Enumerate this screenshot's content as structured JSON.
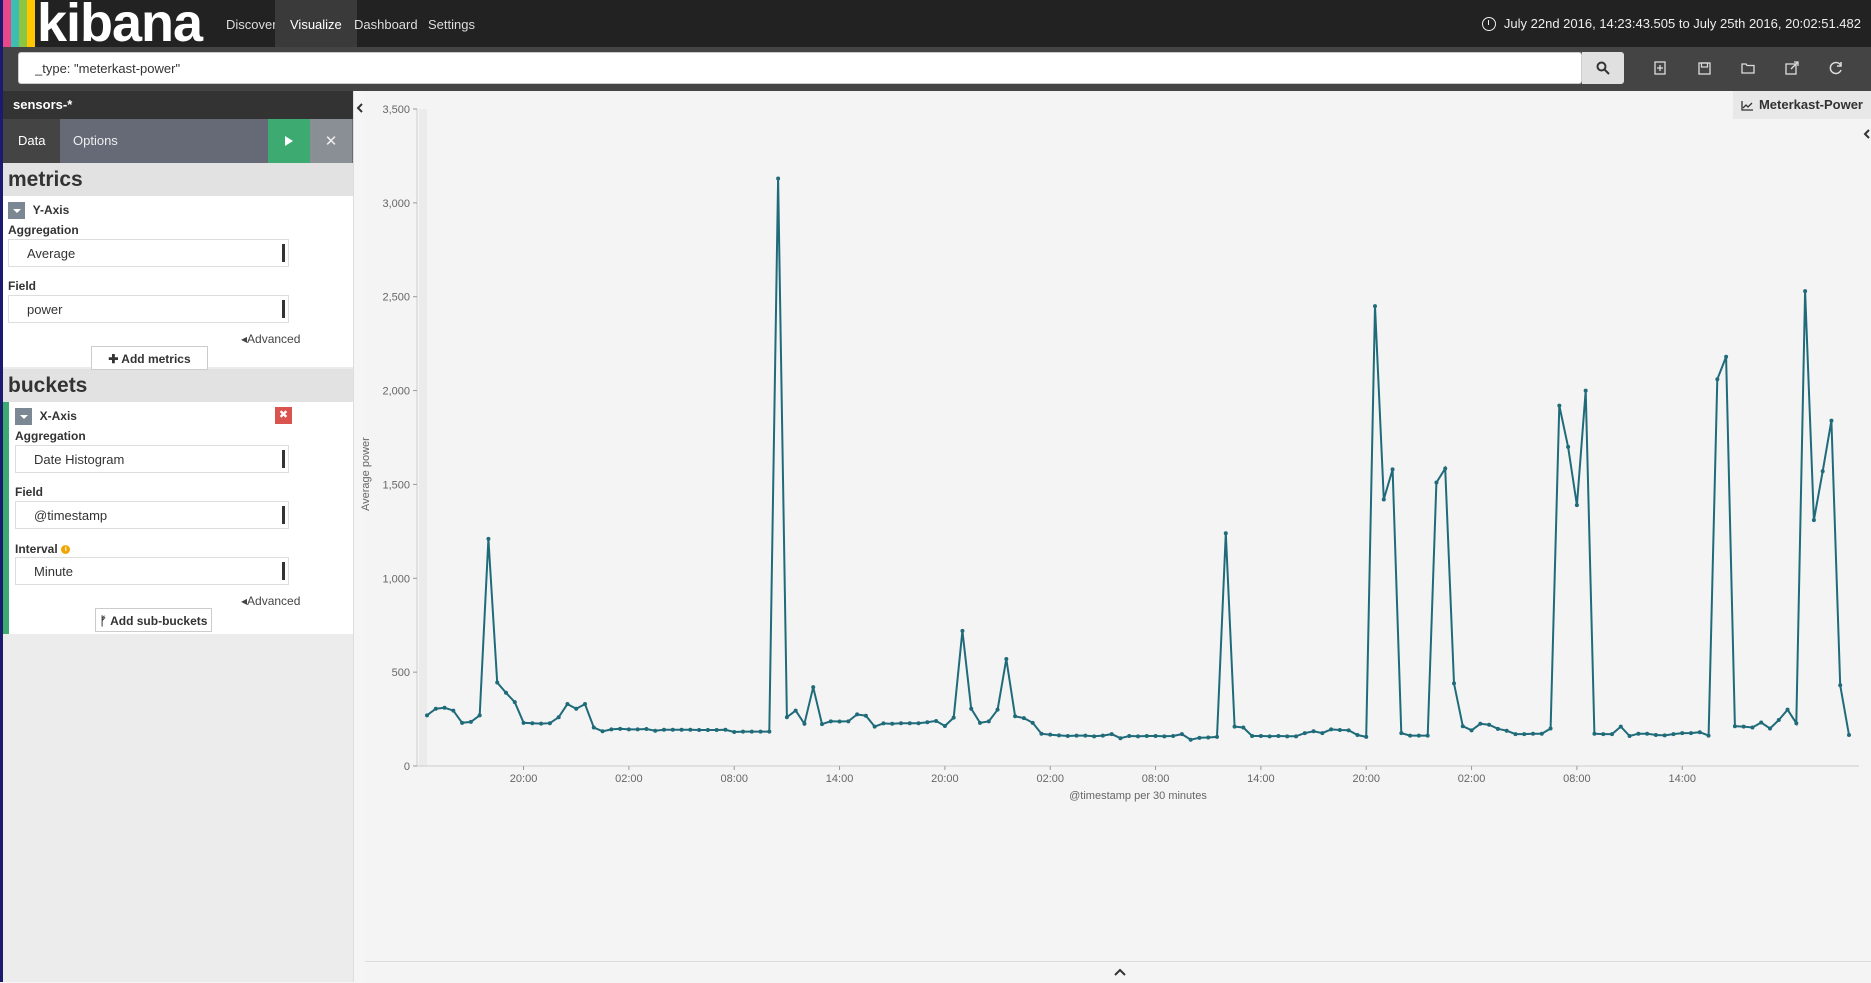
{
  "colors": {
    "navbar_bg": "#222222",
    "accent_green": "#3caa71",
    "line_color": "#1f6b7a",
    "delete_red": "#d9534f",
    "logo_stripes": [
      "#e8478b",
      "#3ebeb0",
      "#8bc541",
      "#ffc700"
    ]
  },
  "nav": {
    "brand": "kibana",
    "items": [
      "Discover",
      "Visualize",
      "Dashboard",
      "Settings"
    ],
    "active": "Visualize",
    "time_range": "July 22nd 2016, 14:23:43.505 to July 25th 2016, 20:02:51.482"
  },
  "search": {
    "query": "_type: \"meterkast-power\"",
    "search_icon": "search-icon"
  },
  "toolbar_icons": [
    "new-icon",
    "save-icon",
    "open-icon",
    "share-icon",
    "refresh-icon"
  ],
  "sidebar": {
    "index_pattern": "sensors-*",
    "tabs": [
      "Data",
      "Options"
    ],
    "active_tab": "Data",
    "metrics": {
      "heading": "metrics",
      "agg_name": "Y-Axis",
      "aggregation_label": "Aggregation",
      "aggregation_value": "Average",
      "field_label": "Field",
      "field_value": "power",
      "advanced": "Advanced",
      "add_label": "Add metrics"
    },
    "buckets": {
      "heading": "buckets",
      "agg_name": "X-Axis",
      "aggregation_label": "Aggregation",
      "aggregation_value": "Date Histogram",
      "field_label": "Field",
      "field_value": "@timestamp",
      "interval_label": "Interval",
      "interval_value": "Minute",
      "advanced": "Advanced",
      "add_label": "Add sub-buckets"
    }
  },
  "vis": {
    "title": "Meterkast-Power"
  },
  "chart_data": {
    "type": "line",
    "xlabel": "@timestamp per 30 minutes",
    "ylabel": "Average power",
    "ylim": [
      0,
      3500
    ],
    "yticks": [
      "0",
      "500",
      "1,000",
      "1,500",
      "2,000",
      "2,500",
      "3,000",
      "3,500"
    ],
    "xticks": [
      "20:00",
      "02:00",
      "08:00",
      "14:00",
      "20:00",
      "02:00",
      "08:00",
      "14:00",
      "20:00",
      "02:00",
      "08:00",
      "14:00"
    ],
    "x_start": "July 22nd 2016, 14:30",
    "x_interval": "30 minutes",
    "grid": false,
    "legend": "none",
    "series": [
      {
        "values": [
          270,
          305,
          310,
          295,
          230,
          235,
          270,
          1210,
          445,
          390,
          340,
          230,
          228,
          226,
          228,
          260,
          330,
          305,
          330,
          205,
          185,
          195,
          198,
          195,
          195,
          197,
          188,
          193,
          193,
          193,
          193,
          192,
          192,
          192,
          193,
          181,
          183,
          183,
          183,
          183,
          3130,
          260,
          295,
          225,
          420,
          223,
          238,
          237,
          238,
          275,
          268,
          210,
          227,
          225,
          228,
          228,
          228,
          233,
          240,
          213,
          258,
          720,
          305,
          230,
          238,
          300,
          570,
          265,
          255,
          230,
          172,
          167,
          163,
          160,
          162,
          162,
          158,
          162,
          170,
          148,
          160,
          158,
          160,
          160,
          158,
          160,
          170,
          140,
          150,
          152,
          155,
          1240,
          210,
          205,
          160,
          160,
          158,
          160,
          158,
          158,
          175,
          185,
          175,
          195,
          192,
          190,
          165,
          155,
          2450,
          1420,
          1580,
          175,
          162,
          162,
          162,
          1510,
          1585,
          440,
          212,
          190,
          225,
          220,
          198,
          188,
          170,
          170,
          172,
          172,
          200,
          1920,
          1700,
          1390,
          2000,
          172,
          170,
          170,
          210,
          160,
          172,
          172,
          165,
          163,
          170,
          175,
          175,
          180,
          162,
          2060,
          2180,
          212,
          210,
          205,
          232,
          200,
          245,
          300,
          228,
          2530,
          1310,
          1570,
          1840,
          430,
          165
        ]
      }
    ]
  }
}
